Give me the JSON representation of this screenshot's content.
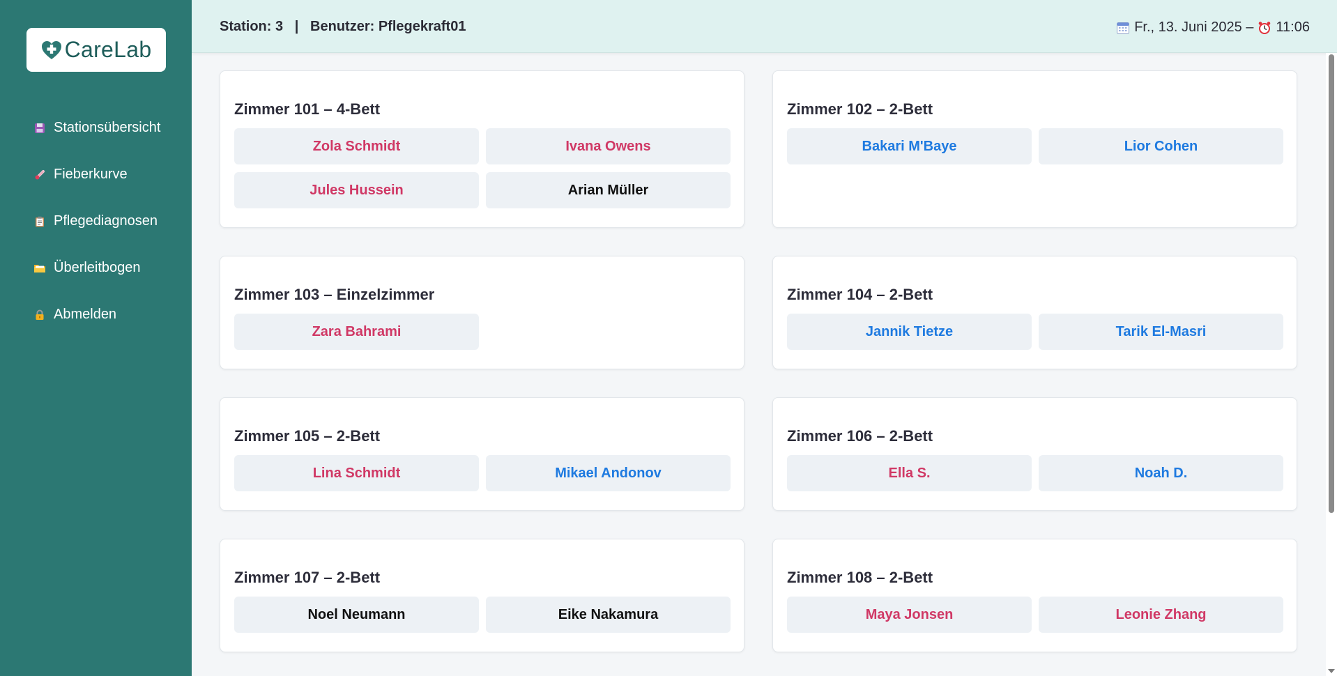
{
  "app": {
    "name": "CareLab"
  },
  "sidebar": {
    "items": [
      {
        "label": "Stationsübersicht",
        "icon": "floppy-disk-icon"
      },
      {
        "label": "Fieberkurve",
        "icon": "thermometer-icon"
      },
      {
        "label": "Pflegediagnosen",
        "icon": "clipboard-icon"
      },
      {
        "label": "Überleitbogen",
        "icon": "folder-icon"
      },
      {
        "label": "Abmelden",
        "icon": "lock-icon"
      }
    ]
  },
  "header": {
    "station": "Station: 3   |   Benutzer: Pflegekraft01",
    "date": "Fr., 13. Juni 2025 –",
    "time": "11:06"
  },
  "rooms": [
    {
      "title": "Zimmer 101 – 4-Bett",
      "patients": [
        {
          "name": "Zola Schmidt",
          "gender": "female"
        },
        {
          "name": "Ivana Owens",
          "gender": "female"
        },
        {
          "name": "Jules Hussein",
          "gender": "female"
        },
        {
          "name": "Arian Müller",
          "gender": "neutral"
        }
      ]
    },
    {
      "title": "Zimmer 102 – 2-Bett",
      "patients": [
        {
          "name": "Bakari M'Baye",
          "gender": "male"
        },
        {
          "name": "Lior Cohen",
          "gender": "male"
        }
      ]
    },
    {
      "title": "Zimmer 103 – Einzelzimmer",
      "patients": [
        {
          "name": "Zara Bahrami",
          "gender": "female"
        }
      ]
    },
    {
      "title": "Zimmer 104 – 2-Bett",
      "patients": [
        {
          "name": "Jannik Tietze",
          "gender": "male"
        },
        {
          "name": "Tarik El-Masri",
          "gender": "male"
        }
      ]
    },
    {
      "title": "Zimmer 105 – 2-Bett",
      "patients": [
        {
          "name": "Lina Schmidt",
          "gender": "female"
        },
        {
          "name": "Mikael Andonov",
          "gender": "male"
        }
      ]
    },
    {
      "title": "Zimmer 106 – 2-Bett",
      "patients": [
        {
          "name": "Ella S.",
          "gender": "female"
        },
        {
          "name": "Noah D.",
          "gender": "male"
        }
      ]
    },
    {
      "title": "Zimmer 107 – 2-Bett",
      "patients": [
        {
          "name": "Noel Neumann",
          "gender": "neutral"
        },
        {
          "name": "Eike Nakamura",
          "gender": "neutral"
        }
      ]
    },
    {
      "title": "Zimmer 108 – 2-Bett",
      "patients": [
        {
          "name": "Maya Jonsen",
          "gender": "female"
        },
        {
          "name": "Leonie Zhang",
          "gender": "female"
        }
      ]
    }
  ],
  "colors": {
    "sidebar": "#2c7873",
    "header": "#dff2f0",
    "female": "#d03865",
    "male": "#1e7ae0",
    "neutral": "#111111"
  }
}
